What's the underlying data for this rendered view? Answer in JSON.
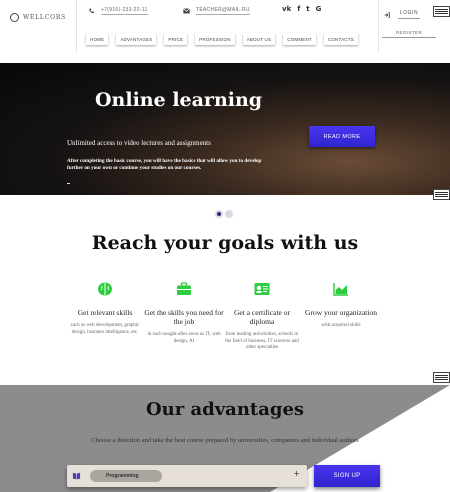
{
  "brand": {
    "name": "WELLCORS"
  },
  "contacts": {
    "phone": "+7(916)-233-22-11",
    "email": "TEACHER@MAIL.RU"
  },
  "social": [
    {
      "icon": "vk-icon",
      "glyph": "vk"
    },
    {
      "icon": "facebook-icon",
      "glyph": "f"
    },
    {
      "icon": "twitter-icon",
      "glyph": "t"
    },
    {
      "icon": "google-icon",
      "glyph": "G"
    }
  ],
  "nav": {
    "items": [
      {
        "name": "nav-home",
        "label": "HOME"
      },
      {
        "name": "nav-advantages",
        "label": "ADVANTAGES"
      },
      {
        "name": "nav-price",
        "label": "PRICE"
      },
      {
        "name": "nav-profession",
        "label": "PROFESSION"
      },
      {
        "name": "nav-about-us",
        "label": "ABOUT US"
      },
      {
        "name": "nav-comment",
        "label": "COMMENT"
      },
      {
        "name": "nav-contacts",
        "label": "CONTACTS"
      }
    ]
  },
  "auth": {
    "login": "LOGIN",
    "register": "REGISTER"
  },
  "hero": {
    "title": "Online learning",
    "subtitle": "Unlimited access to video lectures and assignments",
    "description": "After completing the basic course, you will have the basics that will allow you to develop further on your own or continue your studies on our courses.",
    "cta": "READ MORE"
  },
  "slider": {
    "active_index": 0,
    "count": 2
  },
  "goals": {
    "title": "Reach your goals with us",
    "items": [
      {
        "icon": "brain-icon",
        "title": "Get relevant skills",
        "desc": "such as web development, graphic design, business intelligence, etc."
      },
      {
        "icon": "briefcase-icon",
        "title": "Get the skills you need for the job",
        "desc": "in such sought-after areas as IT, web design, AI"
      },
      {
        "icon": "certificate-icon",
        "title": "Get a certificate or diploma",
        "desc": "from leading universities, schools in the field of business, IT sciences and other specialties"
      },
      {
        "icon": "chart-icon",
        "title": "Grow your organization",
        "desc": "with acquired skills"
      }
    ]
  },
  "advantages": {
    "title": "Our advantages",
    "description": "Choose a direction and take the best course prepared by universities, companies and individual authors",
    "search": {
      "selected": "Programming",
      "plus": "+"
    },
    "cta": "SIGN UP"
  },
  "colors": {
    "accent": "#3a2be0",
    "green": "#2ecc40",
    "hero_bg": "#0d0b0b",
    "adv_bg": "#8c8c8c"
  }
}
